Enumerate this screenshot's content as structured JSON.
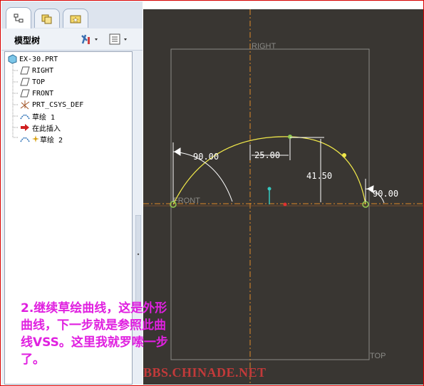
{
  "model_tree": {
    "title": "模型树",
    "items": [
      {
        "label": "EX-30.PRT",
        "icon": "part-icon"
      },
      {
        "label": "RIGHT",
        "icon": "datum-plane-icon"
      },
      {
        "label": "TOP",
        "icon": "datum-plane-icon"
      },
      {
        "label": "FRONT",
        "icon": "datum-plane-icon"
      },
      {
        "label": "PRT_CSYS_DEF",
        "icon": "csys-icon"
      },
      {
        "label": "草绘 1",
        "icon": "sketch-icon"
      },
      {
        "label": "在此插入",
        "icon": "insert-here-arrow-icon"
      },
      {
        "label": "草绘 2",
        "icon": "sketch-active-icon"
      }
    ]
  },
  "sketch": {
    "datum_labels": {
      "right": "RIGHT",
      "top": "TOP",
      "front": "FRONT"
    },
    "dimensions": {
      "angle_left": "90.00",
      "horizontal": "25.00",
      "height": "41.50",
      "angle_right": "90.00"
    }
  },
  "annotation": {
    "lines": [
      "2.继续草绘曲线，这是外形",
      "曲线，下一步就是参照此曲",
      "线VSS。这里我就罗嗦一步",
      "了。"
    ]
  },
  "watermark": "BBS.CHINADE.NET",
  "colors": {
    "canvas_bg": "#393632",
    "datum_line": "#e08a28",
    "sketch_curve": "#f0e84a",
    "dimension": "#ffffff",
    "annotation_text": "#e020e0",
    "frame_border": "#d80000"
  }
}
